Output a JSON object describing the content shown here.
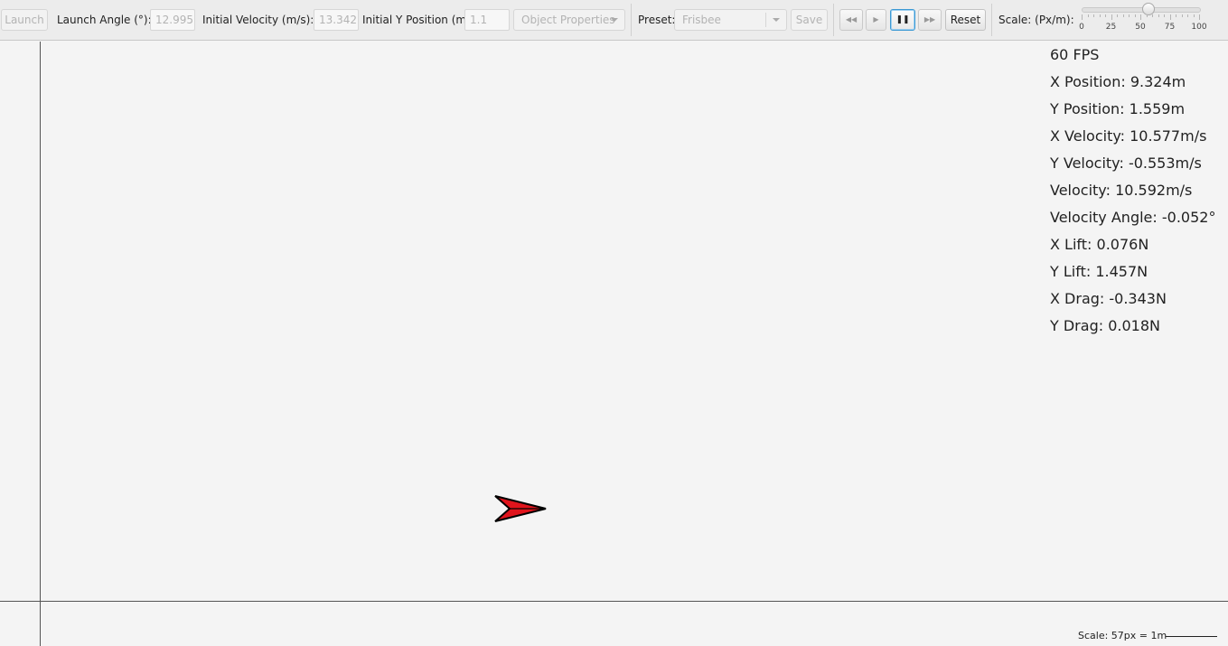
{
  "toolbar": {
    "launch_label": "Launch",
    "launch_angle_label": "Launch Angle (°):",
    "launch_angle_value": "12.995",
    "initial_velocity_label": "Initial Velocity (m/s):",
    "initial_velocity_value": "13.342",
    "initial_y_label": "Initial Y Position (m):",
    "initial_y_value": "1.1",
    "object_properties_label": "Object Properties",
    "preset_label": "Preset:",
    "preset_value": "Frisbee",
    "save_label": "Save",
    "reset_label": "Reset",
    "scale_label": "Scale: (Px/m):",
    "scale_slider": {
      "min": 0,
      "max": 100,
      "value": 57,
      "tick_labels": [
        "0",
        "25",
        "50",
        "75",
        "100"
      ]
    }
  },
  "readouts": {
    "fps": "60 FPS",
    "x_position": "X Position: 9.324m",
    "y_position": "Y Position: 1.559m",
    "x_velocity": "X Velocity: 10.577m/s",
    "y_velocity": "Y Velocity: -0.553m/s",
    "velocity": "Velocity: 10.592m/s",
    "velocity_angle": "Velocity Angle: -0.052°",
    "x_lift": "X Lift: 0.076N",
    "y_lift": "Y Lift: 1.457N",
    "x_drag": "X Drag: -0.343N",
    "y_drag": "Y Drag: 0.018N"
  },
  "scale_indicator": "Scale: 57px = 1m",
  "colors": {
    "projectile_fill": "#e0141c",
    "projectile_outline": "#000000",
    "background": "#f4f4f4",
    "axis": "#555555",
    "focus_accent": "#3b99d4"
  },
  "icons": {
    "rewind": "double-left-triangle",
    "step": "right-triangle",
    "pause": "pause-bars",
    "fast_forward": "double-right-triangle"
  }
}
